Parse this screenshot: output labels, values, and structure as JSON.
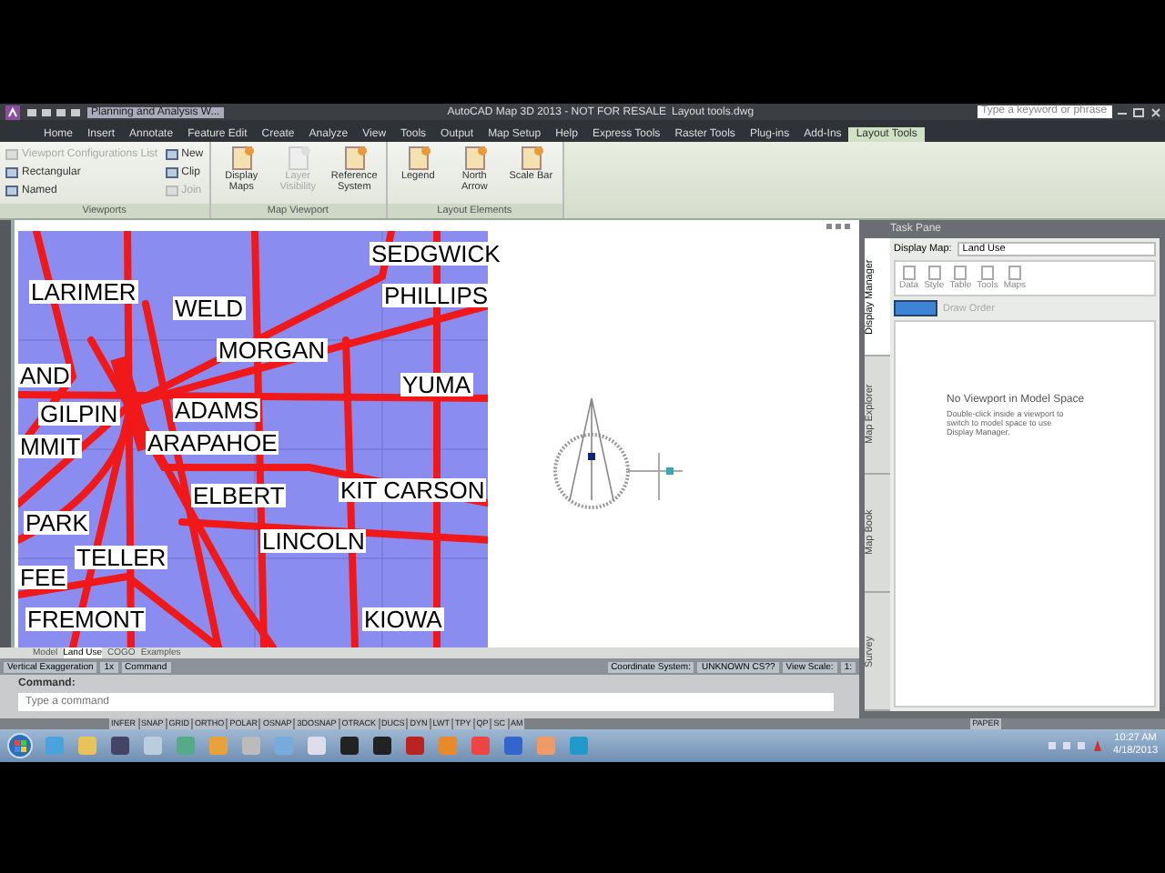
{
  "title_bar": {
    "document_tab": "Planning and Analysis W...",
    "title": "AutoCAD Map 3D 2013 - NOT FOR RESALE",
    "file": "Layout tools.dwg",
    "search": {
      "placeholder": "Type a keyword or phrase"
    }
  },
  "ribbon_tabs": [
    {
      "label": "Home",
      "selected": false
    },
    {
      "label": "Insert",
      "selected": false
    },
    {
      "label": "Annotate",
      "selected": false
    },
    {
      "label": "Feature Edit",
      "selected": false
    },
    {
      "label": "Create",
      "selected": false
    },
    {
      "label": "Analyze",
      "selected": false
    },
    {
      "label": "View",
      "selected": false
    },
    {
      "label": "Tools",
      "selected": false
    },
    {
      "label": "Output",
      "selected": false
    },
    {
      "label": "Map Setup",
      "selected": false
    },
    {
      "label": "Help",
      "selected": false
    },
    {
      "label": "Express Tools",
      "selected": false
    },
    {
      "label": "Raster Tools",
      "selected": false
    },
    {
      "label": "Plug-ins",
      "selected": false
    },
    {
      "label": "Add-Ins",
      "selected": false
    },
    {
      "label": "Layout Tools",
      "selected": true
    }
  ],
  "ribbon_groups": [
    {
      "title": "Viewports",
      "items": [
        {
          "kind": "small",
          "label": "Viewport Configurations List",
          "disabled": true
        },
        {
          "kind": "small",
          "label": "Rectangular",
          "disabled": false
        },
        {
          "kind": "small",
          "label": "Named",
          "disabled": false
        },
        {
          "kind": "small",
          "label": "New",
          "disabled": false
        },
        {
          "kind": "small",
          "label": "Clip",
          "disabled": false
        },
        {
          "kind": "small",
          "label": "Join",
          "disabled": true
        }
      ]
    },
    {
      "title": "Map Viewport",
      "items": [
        {
          "kind": "large",
          "label": "Display Maps",
          "disabled": false
        },
        {
          "kind": "large",
          "label": "Layer Visibility",
          "disabled": true
        },
        {
          "kind": "large",
          "label": "Reference System",
          "disabled": false
        }
      ]
    },
    {
      "title": "Layout Elements",
      "items": [
        {
          "kind": "large",
          "label": "Legend",
          "disabled": false
        },
        {
          "kind": "large",
          "label": "North Arrow",
          "disabled": false
        },
        {
          "kind": "large",
          "label": "Scale Bar",
          "disabled": false
        }
      ]
    }
  ],
  "map": {
    "labels": [
      "SEDGWICK",
      "LARIMER",
      "WELD",
      "PHILLIPS",
      "MORGAN",
      "AND",
      "YUMA",
      "GILPIN",
      "ADAMS",
      "MMIT",
      "ARAPAHOE",
      "ELBERT",
      "KIT CARSON",
      "PARK",
      "TELLER",
      "LINCOLN",
      "FEE",
      "FREMONT",
      "KIOWA"
    ]
  },
  "layout_tabs": [
    {
      "label": "Model",
      "selected": false
    },
    {
      "label": "Land Use",
      "selected": true
    },
    {
      "label": "COGO",
      "selected": false
    },
    {
      "label": "Examples",
      "selected": false
    }
  ],
  "status_bar": {
    "left": [
      "Vertical Exaggeration",
      "1x",
      "Command"
    ],
    "right": [
      "Coordinate System:",
      "UNKNOWN CS??",
      "View Scale:",
      "1:"
    ]
  },
  "command": {
    "history": "Command:",
    "placeholder": "Type a command"
  },
  "toggles": [
    "INFER",
    "SNAP",
    "GRID",
    "ORTHO",
    "POLAR",
    "OSNAP",
    "3DOSNAP",
    "OTRACK",
    "DUCS",
    "DYN",
    "LWT",
    "TPY",
    "QP",
    "SC",
    "AM"
  ],
  "paper": "PAPER",
  "task_pane": {
    "title": "Task Pane",
    "display_map_label": "Display Map:",
    "display_map": "Land Use",
    "tools": [
      "Data",
      "Style",
      "Table",
      "Tools",
      "Maps"
    ],
    "draw_order": "Draw Order",
    "message_title": "No Viewport in Model Space",
    "message": "Double-click inside a viewport to switch to model space to use Display Manager.",
    "side_tabs": [
      {
        "label": "Display Manager",
        "selected": true
      },
      {
        "label": "Map Explorer",
        "selected": false
      },
      {
        "label": "Map Book",
        "selected": false
      },
      {
        "label": "Survey",
        "selected": false
      }
    ]
  },
  "taskbar": {
    "time": "10:27 AM",
    "date": "4/18/2013"
  }
}
